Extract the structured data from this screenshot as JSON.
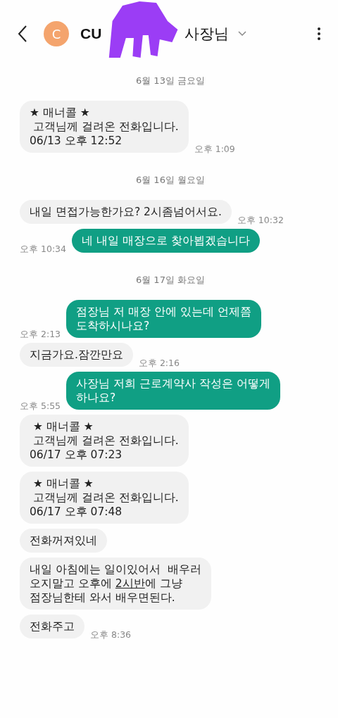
{
  "header": {
    "avatar_letter": "C",
    "name_start": "CU",
    "name_end": "사장님",
    "redacted": true
  },
  "items": [
    {
      "kind": "date",
      "text": "6월 13일 금요일"
    },
    {
      "kind": "message",
      "outgoing": false,
      "parts": [
        {
          "kind": "text",
          "text": "★ 매너콜 ★\n 고객님께 걸려온 전화입니다.\n06/13 오후 12:52"
        }
      ],
      "time": "오후 1:09"
    },
    {
      "kind": "date",
      "text": "6월 16일 월요일"
    },
    {
      "kind": "message",
      "outgoing": false,
      "parts": [
        {
          "kind": "text",
          "text": "내일 면접가능한가요? 2시좀넘어서요."
        }
      ],
      "time": "오후 10:32"
    },
    {
      "kind": "message",
      "outgoing": true,
      "parts": [
        {
          "kind": "text",
          "text": "네 내일 매장으로 찾아뵙겠습니다"
        }
      ],
      "time": "오후 10:34"
    },
    {
      "kind": "date",
      "text": "6월 17일 화요일"
    },
    {
      "kind": "message",
      "outgoing": true,
      "parts": [
        {
          "kind": "text",
          "text": "점장님 저 매장 안에 있는데 언제쯤\n도착하시나요?"
        }
      ],
      "time": "오후 2:13"
    },
    {
      "kind": "message",
      "outgoing": false,
      "parts": [
        {
          "kind": "text",
          "text": "지금가요.잠깐만요"
        }
      ],
      "time": "오후 2:16"
    },
    {
      "kind": "message",
      "outgoing": true,
      "parts": [
        {
          "kind": "text",
          "text": "사장님 저희 근로계약사 작성은 어떻게\n하나요?"
        }
      ],
      "time": "오후 5:55"
    },
    {
      "kind": "message",
      "outgoing": false,
      "parts": [
        {
          "kind": "text",
          "text": " ★ 매너콜 ★\n 고객님께 걸려온 전화입니다.\n06/17 오후 07:23"
        }
      ]
    },
    {
      "kind": "message",
      "outgoing": false,
      "parts": [
        {
          "kind": "text",
          "text": " ★ 매너콜 ★\n 고객님께 걸려온 전화입니다.\n06/17 오후 07:48"
        }
      ]
    },
    {
      "kind": "message",
      "outgoing": false,
      "parts": [
        {
          "kind": "text",
          "text": "전화꺼져있네"
        }
      ]
    },
    {
      "kind": "message",
      "outgoing": false,
      "parts": [
        {
          "kind": "text",
          "text": "내일 아침에는 일이있어서  배우러\n오지말고 오후에 "
        },
        {
          "kind": "link",
          "text": "2시반"
        },
        {
          "kind": "text",
          "text": "에 그냥\n점장님한테 와서 배우면된다."
        }
      ]
    },
    {
      "kind": "message",
      "outgoing": false,
      "parts": [
        {
          "kind": "text",
          "text": "전화주고"
        }
      ],
      "time": "오후 8:36"
    }
  ]
}
